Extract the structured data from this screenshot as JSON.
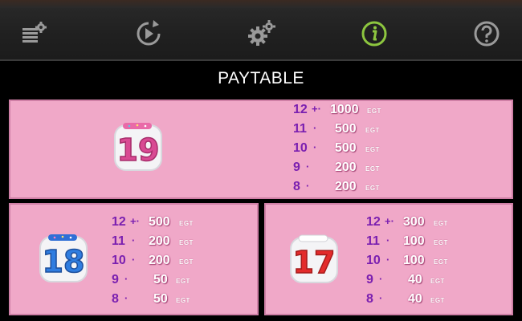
{
  "nav": {
    "items": [
      {
        "name": "autoplay-settings",
        "icon": "stacked-coins-gear-icon"
      },
      {
        "name": "replay",
        "icon": "replay-icon"
      },
      {
        "name": "settings",
        "icon": "gears-icon"
      },
      {
        "name": "info",
        "icon": "info-icon",
        "active": true
      },
      {
        "name": "help",
        "icon": "question-icon"
      }
    ],
    "active_color": "#8dc63f",
    "icon_color": "#9a9a9a"
  },
  "title": "PAYTABLE",
  "symbols": [
    {
      "symbol": "dice-19",
      "number": "19",
      "rows": [
        {
          "count": "12",
          "sep": "+·",
          "amount": "1000",
          "currency": "EGT"
        },
        {
          "count": "11",
          "sep": "·",
          "amount": "500",
          "currency": "EGT"
        },
        {
          "count": "10",
          "sep": "·",
          "amount": "500",
          "currency": "EGT"
        },
        {
          "count": "9",
          "sep": "·",
          "amount": "200",
          "currency": "EGT"
        },
        {
          "count": "8",
          "sep": "·",
          "amount": "200",
          "currency": "EGT"
        }
      ]
    },
    {
      "symbol": "dice-18",
      "number": "18",
      "rows": [
        {
          "count": "12",
          "sep": "+·",
          "amount": "500",
          "currency": "EGT"
        },
        {
          "count": "11",
          "sep": "·",
          "amount": "200",
          "currency": "EGT"
        },
        {
          "count": "10",
          "sep": "·",
          "amount": "200",
          "currency": "EGT"
        },
        {
          "count": "9",
          "sep": "·",
          "amount": "50",
          "currency": "EGT"
        },
        {
          "count": "8",
          "sep": "·",
          "amount": "50",
          "currency": "EGT"
        }
      ]
    },
    {
      "symbol": "dice-17",
      "number": "17",
      "rows": [
        {
          "count": "12",
          "sep": "+·",
          "amount": "300",
          "currency": "EGT"
        },
        {
          "count": "11",
          "sep": "·",
          "amount": "100",
          "currency": "EGT"
        },
        {
          "count": "10",
          "sep": "·",
          "amount": "100",
          "currency": "EGT"
        },
        {
          "count": "9",
          "sep": "·",
          "amount": "40",
          "currency": "EGT"
        },
        {
          "count": "8",
          "sep": "·",
          "amount": "40",
          "currency": "EGT"
        }
      ]
    }
  ],
  "colors": {
    "panel_bg": "#f0a8c8",
    "count_color": "#7a1fb0",
    "amount_color": "#ffffff"
  }
}
